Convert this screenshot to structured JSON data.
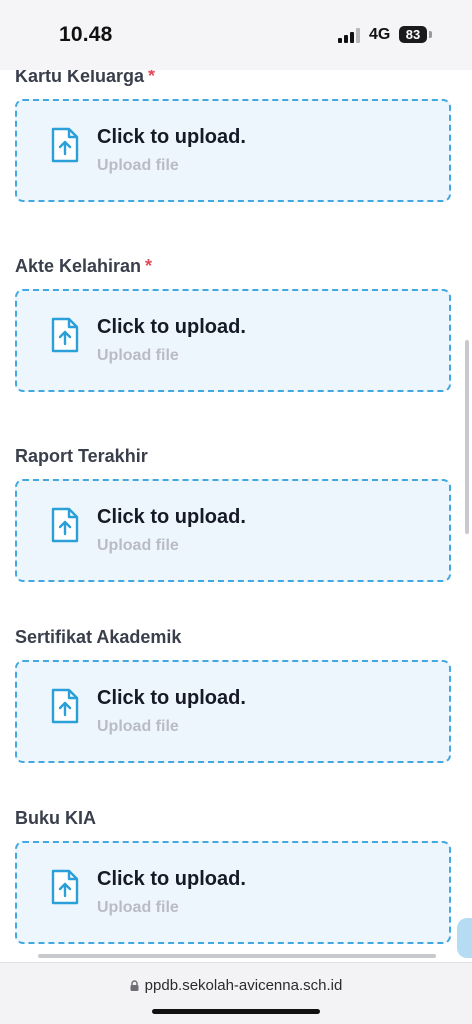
{
  "status_bar": {
    "time": "10.48",
    "network": "4G",
    "battery": "83"
  },
  "upload_sections": [
    {
      "label": "Kartu Keluarga",
      "required": "*",
      "title": "Click to upload.",
      "subtitle": "Upload file"
    },
    {
      "label": "Akte Kelahiran",
      "required": "*",
      "title": "Click to upload.",
      "subtitle": "Upload file"
    },
    {
      "label": "Raport Terakhir",
      "required": "",
      "title": "Click to upload.",
      "subtitle": "Upload file"
    },
    {
      "label": "Sertifikat Akademik",
      "required": "",
      "title": "Click to upload.",
      "subtitle": "Upload file"
    },
    {
      "label": "Buku KIA",
      "required": "",
      "title": "Click to upload.",
      "subtitle": "Upload file"
    }
  ],
  "browser": {
    "url": "ppdb.sekolah-avicenna.sch.id"
  },
  "icons": {
    "upload": "file-upload-icon",
    "lock": "lock-icon",
    "signal": "signal-icon"
  },
  "colors": {
    "accent": "#43a8df",
    "upload_bg": "#eef6fd",
    "required": "#e24a59"
  }
}
